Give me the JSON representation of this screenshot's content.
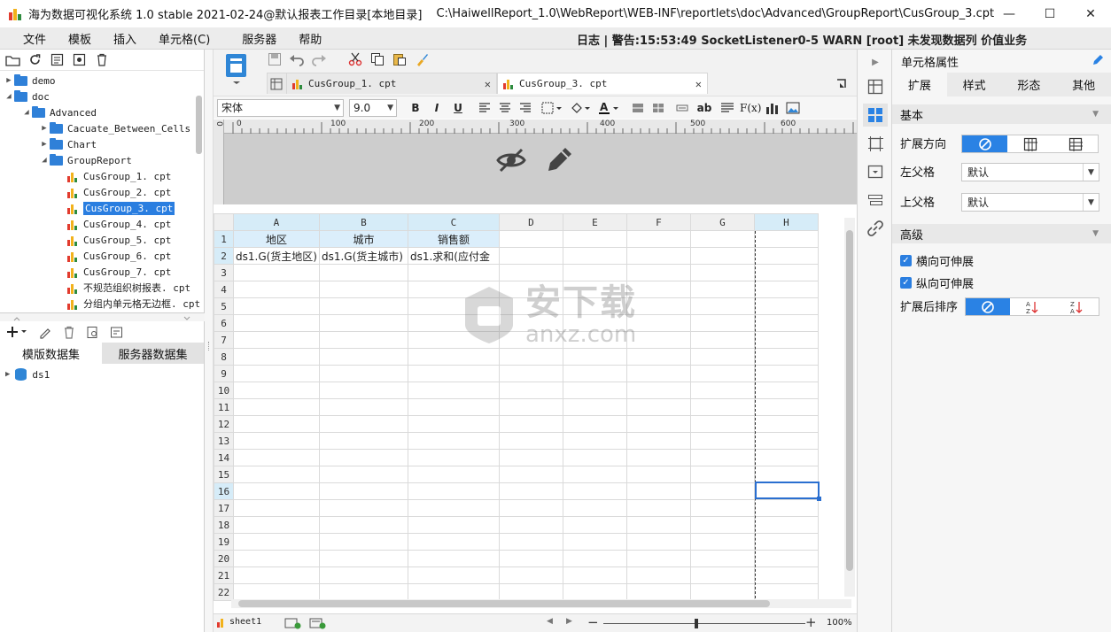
{
  "window": {
    "title": "海为数据可视化系统 1.0 stable 2021-02-24@默认报表工作目录[本地目录]",
    "path": "C:\\HaiwellReport_1.0\\WebReport\\WEB-INF\\reportlets\\doc\\Advanced\\GroupReport\\CusGroup_3.cpt",
    "minimize": "—",
    "maximize": "☐",
    "close": "✕"
  },
  "menu": {
    "items": [
      "文件",
      "模板",
      "插入",
      "单元格(C)",
      "服务器",
      "帮助"
    ],
    "log": "日志 | 警告:15:53:49 SocketListener0-5 WARN [root] 未发现数据列 价值业务"
  },
  "tree": {
    "items": [
      {
        "label": "demo",
        "type": "folder",
        "level": 0,
        "expanded": false
      },
      {
        "label": "doc",
        "type": "folder",
        "level": 0,
        "expanded": true
      },
      {
        "label": "Advanced",
        "type": "folder",
        "level": 1,
        "expanded": true
      },
      {
        "label": "Cacuate_Between_Cells",
        "type": "folder",
        "level": 2,
        "expanded": false
      },
      {
        "label": "Chart",
        "type": "folder",
        "level": 2,
        "expanded": false
      },
      {
        "label": "GroupReport",
        "type": "folder",
        "level": 2,
        "expanded": true
      },
      {
        "label": "CusGroup_1. cpt",
        "type": "file",
        "level": 3
      },
      {
        "label": "CusGroup_2. cpt",
        "type": "file",
        "level": 3
      },
      {
        "label": "CusGroup_3. cpt",
        "type": "file",
        "level": 3,
        "selected": true
      },
      {
        "label": "CusGroup_4. cpt",
        "type": "file",
        "level": 3
      },
      {
        "label": "CusGroup_5. cpt",
        "type": "file",
        "level": 3
      },
      {
        "label": "CusGroup_6. cpt",
        "type": "file",
        "level": 3
      },
      {
        "label": "CusGroup_7. cpt",
        "type": "file",
        "level": 3
      },
      {
        "label": "不规范组织树报表. cpt",
        "type": "file",
        "level": 3
      },
      {
        "label": "分组内单元格无边框. cpt",
        "type": "file",
        "level": 3
      }
    ]
  },
  "datasets": {
    "tab_template": "模版数据集",
    "tab_server": "服务器数据集",
    "items": [
      "ds1"
    ]
  },
  "editor": {
    "tabs": [
      {
        "label": "CusGroup_1. cpt"
      },
      {
        "label": "CusGroup_3. cpt"
      }
    ],
    "tab_close": "✕",
    "font": "宋体",
    "font_size": "9.0",
    "ruler": [
      "0",
      "100",
      "200",
      "300",
      "400",
      "500",
      "600"
    ]
  },
  "sheet": {
    "columns": [
      "A",
      "B",
      "C",
      "D",
      "E",
      "F",
      "G",
      "H"
    ],
    "rows": [
      "1",
      "2",
      "3",
      "4",
      "5",
      "6",
      "7",
      "8",
      "9",
      "10",
      "11",
      "12",
      "13",
      "14",
      "15",
      "16",
      "17",
      "18",
      "19",
      "20",
      "21",
      "22"
    ],
    "row1": [
      "地区",
      "城市",
      "销售额"
    ],
    "row2": [
      "ds1.G(货主地区)",
      "ds1.G(货主城市)",
      "ds1.求和(应付金"
    ],
    "sheet_name": "sheet1",
    "zoom": "100%"
  },
  "props": {
    "title": "单元格属性",
    "tabs": [
      "扩展",
      "样式",
      "形态",
      "其他"
    ],
    "basic": "基本",
    "expand_direction": "扩展方向",
    "left_parent": "左父格",
    "left_parent_value": "默认",
    "top_parent": "上父格",
    "top_parent_value": "默认",
    "advanced": "高级",
    "h_expand": "横向可伸展",
    "v_expand": "纵向可伸展",
    "sort_after": "扩展后排序"
  },
  "watermark": {
    "cn": "安下载",
    "en": "anxz.com"
  },
  "colors": {
    "accent": "#2a82e4",
    "selection": "#2a7ee0",
    "header_highlight": "#dbeefb"
  }
}
